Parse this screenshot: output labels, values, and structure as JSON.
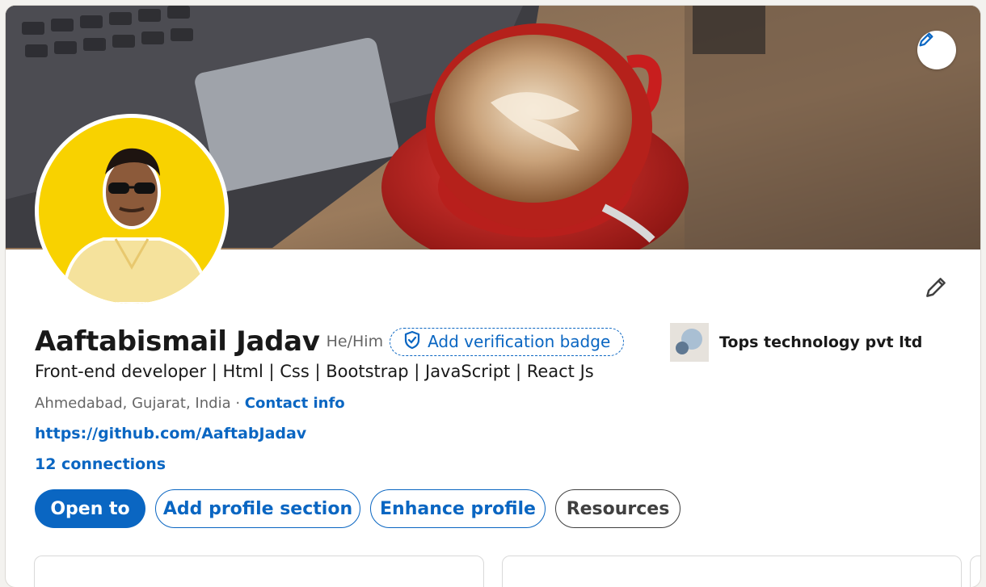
{
  "profile": {
    "name": "Aaftabismail Jadav",
    "pronouns": "He/Him",
    "verification_badge_label": "Add verification badge",
    "headline": "Front-end developer | Html | Css | Bootstrap | JavaScript | React Js",
    "location": "Ahmedabad, Gujarat, India",
    "separator": " · ",
    "contact_info_label": "Contact info",
    "website": "https://github.com/AaftabJadav",
    "connections": "12 connections"
  },
  "company": {
    "name": "Tops technology pvt ltd"
  },
  "actions": {
    "open_to": "Open to",
    "add_profile_section": "Add profile section",
    "enhance_profile": "Enhance profile",
    "resources": "Resources"
  },
  "icons": {
    "cover_edit": "pencil-icon",
    "intro_edit": "pencil-icon",
    "verify": "shield-check-icon"
  },
  "colors": {
    "brand_blue": "#0a66c2",
    "avatar_background": "#f8d200"
  }
}
